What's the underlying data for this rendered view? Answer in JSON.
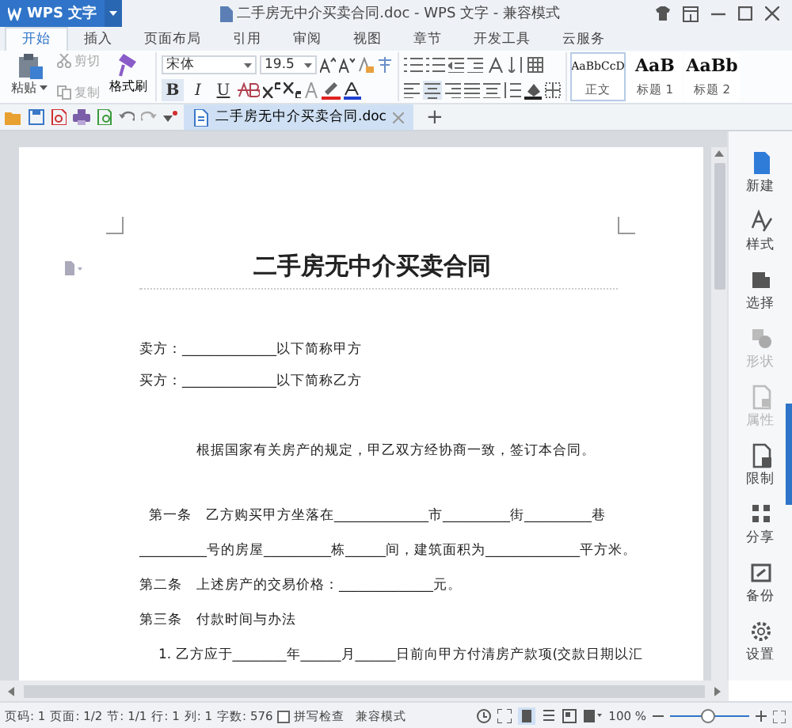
{
  "title_bar": {
    "app_button": "WPS 文字",
    "title": "二手房无中介买卖合同.doc - WPS 文字 - 兼容模式"
  },
  "tabs": [
    {
      "label": "开始",
      "selected": true
    },
    {
      "label": "插入",
      "selected": false
    },
    {
      "label": "页面布局",
      "selected": false
    },
    {
      "label": "引用",
      "selected": false
    },
    {
      "label": "审阅",
      "selected": false
    },
    {
      "label": "视图",
      "selected": false
    },
    {
      "label": "章节",
      "selected": false
    },
    {
      "label": "开发工具",
      "selected": false
    },
    {
      "label": "云服务",
      "selected": false
    }
  ],
  "ribbon": {
    "paste": "粘贴",
    "clipboard_items": [
      {
        "label": "剪切",
        "disabled": true
      },
      {
        "label": "复制",
        "disabled": true
      }
    ],
    "format_painter": "格式刷",
    "font": {
      "name": "宋体",
      "size": "19.5",
      "format_buttons": [
        "B",
        "I",
        "U"
      ]
    },
    "styles": [
      {
        "preview": "AaBbCcD",
        "name": "正文",
        "selected": true
      },
      {
        "preview": "AaB",
        "name": "标题 1",
        "selected": false
      },
      {
        "preview": "AaBb",
        "name": "标题 2",
        "selected": false
      }
    ]
  },
  "document_tabs": [
    {
      "label": "二手房无中介买卖合同.doc",
      "selected": true
    }
  ],
  "new_tab": "+",
  "document": {
    "paragraphs": [
      {
        "kind": "title",
        "text": "二手房无中介买卖合同"
      },
      {
        "kind": "party",
        "text": "卖方：______________以下简称甲方"
      },
      {
        "kind": "party",
        "text": "买方：______________以下简称乙方"
      },
      {
        "kind": "preamble",
        "text": "根据国家有关房产的规定，甲乙双方经协商一致，签订本合同。"
      },
      {
        "kind": "clause",
        "text": "第一条　乙方购买甲方坐落在______________市__________街__________巷"
      },
      {
        "kind": "continuation",
        "text": "__________号的房屋__________栋______间，建筑面积为______________平方米。"
      },
      {
        "kind": "clause",
        "text": "第二条　上述房产的交易价格：______________元。"
      },
      {
        "kind": "clause",
        "text": "第三条　付款时间与办法"
      },
      {
        "kind": "item",
        "text": "1. 乙方应于________年______月______日前向甲方付清房产款项(交款日期以汇"
      }
    ]
  },
  "side_panel": [
    {
      "label": "新建",
      "disabled": false
    },
    {
      "label": "样式",
      "disabled": false
    },
    {
      "label": "选择",
      "disabled": false
    },
    {
      "label": "形状",
      "disabled": true
    },
    {
      "label": "属性",
      "disabled": true
    },
    {
      "label": "限制",
      "disabled": false
    },
    {
      "label": "分享",
      "disabled": false
    },
    {
      "label": "备份",
      "disabled": false
    },
    {
      "label": "设置",
      "disabled": false
    }
  ],
  "status_bar": {
    "items": [
      "页码: 1",
      "页面: 1/2",
      "节: 1/1",
      "行: 1",
      "列: 1",
      "字数: 576"
    ],
    "spell_check": {
      "label": "拼写检查",
      "checked": false
    },
    "mode": "兼容模式",
    "zoom": "100 %",
    "zoom_slider": {
      "level": 0.48
    }
  }
}
